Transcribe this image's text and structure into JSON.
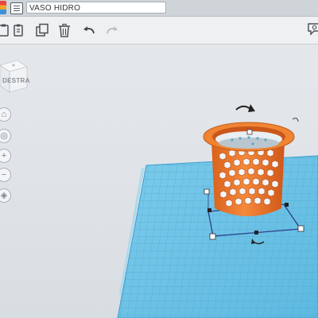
{
  "header": {
    "design_name": "VASO HIDRO"
  },
  "viewcube": {
    "face_label": "DESTRA"
  },
  "navigation": {
    "zoom_in": "+",
    "zoom_out": "−"
  },
  "colors": {
    "workplane": "#6fc4e6",
    "model": "#f07c2c",
    "background": "#e3e6e9"
  },
  "icons": [
    "app-logo",
    "list-icon",
    "paste-icon",
    "copy-icon",
    "duplicate-icon",
    "delete-icon",
    "undo-icon",
    "redo-icon",
    "comment-icon",
    "home-icon",
    "fit-icon",
    "zoom-in-icon",
    "zoom-out-icon",
    "perspective-icon",
    "rotate-handle-icon"
  ]
}
